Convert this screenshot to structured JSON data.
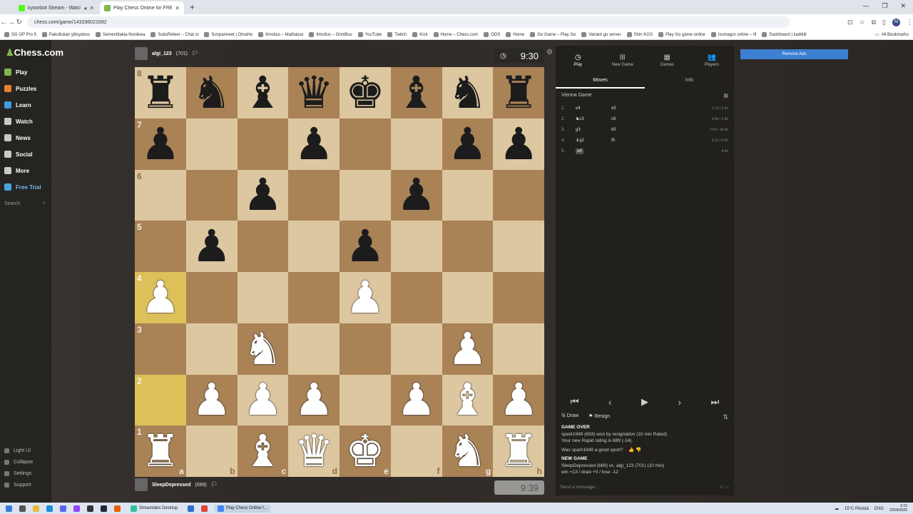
{
  "browser": {
    "tabs": [
      {
        "title": "kyoorbot Stream - Watch L",
        "icon_color": "#53fc18",
        "active": false
      },
      {
        "title": "Play Chess Online for FREE - 2",
        "icon_color": "#81b64c",
        "active": true
      }
    ],
    "new_tab": "+",
    "url": "chess.com/game/143336021692",
    "profile_initial": "M",
    "bookmarks": [
      "SG OP Pro 5",
      "Pakollukan ylitsydess",
      "Sementitakia Nordeea",
      "SubsReleer – Chat st",
      "Sunpanneet | OmaHo",
      "Ilmoitus – Mathalusi",
      "Ilmoitus – OnniBus",
      "YouTube",
      "Twitch",
      "Kick",
      "Home – Chess.com",
      "ODS",
      "Home",
      "Go Game – Play Go",
      "Variant go server",
      "Shin KGS",
      "Play Go game online",
      "Isumagor online – Ill",
      "Dashboard | kadikill"
    ],
    "all_bookmarks": "All Bookmarks"
  },
  "sidebar": {
    "logo": "Chess",
    "logo_suffix": ".com",
    "items": [
      {
        "label": "Play",
        "icon": "pawn-icon",
        "color": "#81b64c"
      },
      {
        "label": "Puzzles",
        "icon": "puzzle-icon",
        "color": "#e8812f"
      },
      {
        "label": "Learn",
        "icon": "graduation-cap-icon",
        "color": "#3d9be0"
      },
      {
        "label": "Watch",
        "icon": "tv-icon",
        "color": "#c9c9c9"
      },
      {
        "label": "News",
        "icon": "newspaper-icon",
        "color": "#c9c9c9"
      },
      {
        "label": "Social",
        "icon": "people-icon",
        "color": "#c9c9c9"
      },
      {
        "label": "More",
        "icon": "dots-icon",
        "color": "#c9c9c9"
      },
      {
        "label": "Free Trial",
        "icon": "diamond-icon",
        "color": "#4aa3df"
      }
    ],
    "search_placeholder": "Search",
    "bottom": [
      {
        "label": "Light UI",
        "icon": "light-icon"
      },
      {
        "label": "Collapse",
        "icon": "collapse-icon"
      },
      {
        "label": "Settings",
        "icon": "gear-icon"
      },
      {
        "label": "Support",
        "icon": "help-icon"
      }
    ]
  },
  "top_player": {
    "name": "algi_123",
    "rating": "(701)",
    "clock": "9:30"
  },
  "bottom_player": {
    "name": "SleepDepressed",
    "rating": "(689)",
    "clock": "9:39"
  },
  "board": {
    "rows": [
      [
        "br",
        "bn",
        "bb",
        "bq",
        "bk",
        "bb",
        "bn",
        "br"
      ],
      [
        "bp",
        "",
        "",
        "bp",
        "",
        "",
        "bp",
        "bp"
      ],
      [
        "",
        "",
        "bp",
        "",
        "",
        "bp",
        "",
        ""
      ],
      [
        "",
        "bp",
        "",
        "",
        "bp",
        "",
        "",
        ""
      ],
      [
        "wp",
        "",
        "",
        "",
        "wp",
        "",
        "",
        ""
      ],
      [
        "",
        "",
        "wn",
        "",
        "",
        "",
        "wp",
        ""
      ],
      [
        "",
        "wp",
        "wp",
        "wp",
        "",
        "wp",
        "wb",
        "wp"
      ],
      [
        "wr",
        "",
        "wb",
        "wq",
        "wk",
        "",
        "wn",
        "wr"
      ]
    ],
    "highlight": [
      "a4",
      "a2"
    ],
    "ranks": [
      "8",
      "7",
      "6",
      "5",
      "4",
      "3",
      "2",
      "1"
    ],
    "files": [
      "a",
      "b",
      "c",
      "d",
      "e",
      "f",
      "g",
      "h"
    ]
  },
  "panel": {
    "tabs": [
      {
        "label": "Play",
        "icon": "play-clock-icon"
      },
      {
        "label": "New Game",
        "icon": "plus-icon"
      },
      {
        "label": "Games",
        "icon": "grid-icon"
      },
      {
        "label": "Players",
        "icon": "players-icon"
      }
    ],
    "subtabs": [
      "Moves",
      "Info"
    ],
    "opening": "Vienna Game",
    "moves": [
      {
        "num": "1.",
        "white": "e4",
        "black": "e5",
        "times": "1.7s / 3.3s"
      },
      {
        "num": "2.",
        "white": "♞c3",
        "black": "c6",
        "times": "4.0s / 1.5s"
      },
      {
        "num": "3.",
        "white": "g3",
        "black": "b5",
        "times": "7.6s / 16.0s"
      },
      {
        "num": "4.",
        "white": "♝g2",
        "black": "f6",
        "times": "2.1s / 4.0s"
      },
      {
        "num": "5.",
        "white": "a4",
        "black": "",
        "times": "4.4s"
      }
    ],
    "actions": {
      "draw": "Draw",
      "resign": "Resign"
    },
    "messages": {
      "game_over_title": "GAME OVER",
      "game_over_text": "spark1949 (693) won by resignation (10 min Rated)",
      "rating_text": "Your new Rapid rating is 689 (-14).",
      "question": "Was spark1949 a good sport?",
      "new_game_title": "NEW GAME",
      "new_game_text": "SleepDepressed (689) vs. algi_123 (701) (10 min)",
      "record": "win +13 / draw +0 / lose -12"
    },
    "chat_placeholder": "Send a message..."
  },
  "remove_ads": "Remove Ads",
  "taskbar": {
    "apps": [
      "Streamlabs Desktop",
      "Play Chess Online f..."
    ],
    "weather": "15°C Pilvistä",
    "lang": "ENG",
    "time": "9.15",
    "date": "20/09/2025"
  }
}
